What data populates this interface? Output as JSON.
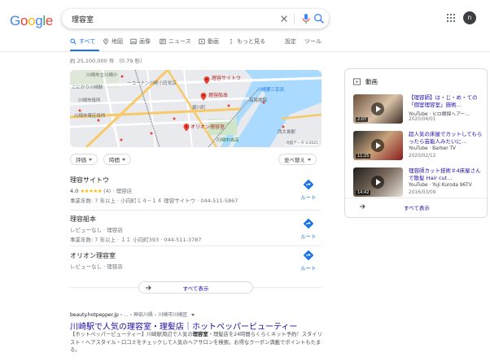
{
  "logo": {
    "letters": [
      "G",
      "o",
      "o",
      "g",
      "l",
      "e"
    ],
    "colors": [
      "#4285f4",
      "#ea4335",
      "#fbbc05",
      "#4285f4",
      "#34a853",
      "#ea4335"
    ]
  },
  "search": {
    "query": "理容室"
  },
  "user": {
    "initial": "n"
  },
  "tabs": [
    {
      "label": "すべて",
      "icon": "search-icon",
      "active": true
    },
    {
      "label": "地図",
      "icon": "map-pin-icon"
    },
    {
      "label": "画像",
      "icon": "image-icon"
    },
    {
      "label": "ニュース",
      "icon": "news-icon"
    },
    {
      "label": "動画",
      "icon": "video-icon"
    },
    {
      "label": "もっと見る",
      "icon": "more-vert-icon"
    }
  ],
  "tools": {
    "settings": "設定",
    "tools": "ツール"
  },
  "stats": "約 25,100,000 件 （0.79 秒）",
  "map": {
    "labels": [
      "理容サイトウ",
      "理容船本",
      "オリオン理容室",
      "川崎市役所",
      "地図データ ©2021",
      "高尾病院",
      "川崎第三京浜",
      "堀川町",
      "西大島駅",
      "こにかり川崎駅",
      "川崎市立川崎小",
      "川崎市東区役所",
      "ーコーナン川崎小田栄店",
      "川崎中央店"
    ]
  },
  "filters": {
    "rating": "評価",
    "hours": "時間",
    "sort": "並べ替え"
  },
  "places": [
    {
      "name": "理容サイトウ",
      "rating": "4.0",
      "stars": "★★★★★",
      "reviews": "(4)",
      "category": "理容店",
      "hours": "事業年数: 7 年以上 · 小向町１４−１４ 理容サイトウ · 044-511-5867",
      "route": "ルート"
    },
    {
      "name": "理容船本",
      "rating_text": "レビューなし",
      "category": "理容店",
      "hours": "事業年数: 7 年以上 · １１ 小向町393 · 044-511-3787",
      "route": "ルート"
    },
    {
      "name": "オリオン理容室",
      "rating_text": "レビューなし",
      "category": "理容店",
      "route": "ルート"
    }
  ],
  "show_all": "すべて表示",
  "organic": {
    "cite_domain": "beauty.hotpepper.jp",
    "cite_path": " › ... › 神奈川県 › 川崎市川崎区",
    "title": "川崎駅で人気の理容室・理髪店｜ホットペッパービューティー",
    "snippet_1": "【ホットペッパービューティー】川崎駅周辺で人気の",
    "snippet_bold": "理容室",
    "snippet_2": "・理髪店を24時間らくらくネット予約！スタイリスト・ヘアスタイル・口コミをチェックして人気のヘアサロンを検索。お得なクーポン満載でポイントもたまる。"
  },
  "videos": {
    "heading": "動画",
    "items": [
      {
        "title": "【理容師】は・じ・め・ての「個室理容室」施術…",
        "source": "YouTube · ヒロ眼探ヘアー…",
        "date": "2020/04/01",
        "duration": "2:07"
      },
      {
        "title": "超人気の床屋でカットしてもらったら芸能人みたいに…",
        "source": "YouTube · Barber TV",
        "date": "2020/02/12",
        "duration": "11:25"
      },
      {
        "title": "理容師カット技術＃4床屋さんで散髪 Hair cut…",
        "source": "YouTube · Yuji Kuroda 96TV",
        "date": "2016/03/09",
        "duration": "14:42"
      }
    ],
    "show_all": "すべて表示"
  }
}
